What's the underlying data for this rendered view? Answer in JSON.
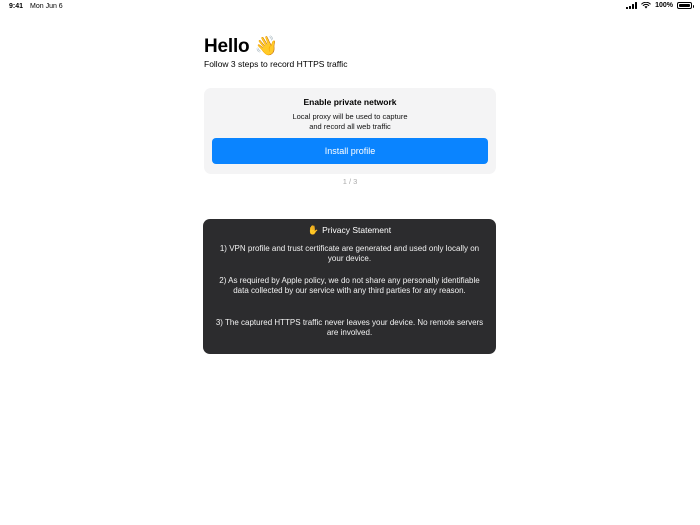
{
  "status_bar": {
    "time": "9:41",
    "date": "Mon Jun 6",
    "battery": "100%"
  },
  "header": {
    "title": "Hello",
    "emoji": "👋",
    "subtitle": "Follow 3 steps to record HTTPS traffic"
  },
  "step": {
    "title": "Enable private network",
    "description_line1": "Local proxy will be used to capture",
    "description_line2": "and record all web traffic",
    "button_label": "Install profile",
    "pager": "1 / 3"
  },
  "privacy": {
    "icon": "✋",
    "title": "Privacy Statement",
    "items": [
      "1) VPN profile and trust certificate are generated and used only locally on your device.",
      "2) As required by Apple policy, we do not share any personally identifiable data collected by our service with any third parties for any reason.",
      "3) The captured HTTPS traffic never leaves your device. No remote servers are involved."
    ]
  },
  "colors": {
    "accent": "#0a84ff",
    "card_background": "#f4f4f5",
    "privacy_background": "#2c2c2e"
  }
}
